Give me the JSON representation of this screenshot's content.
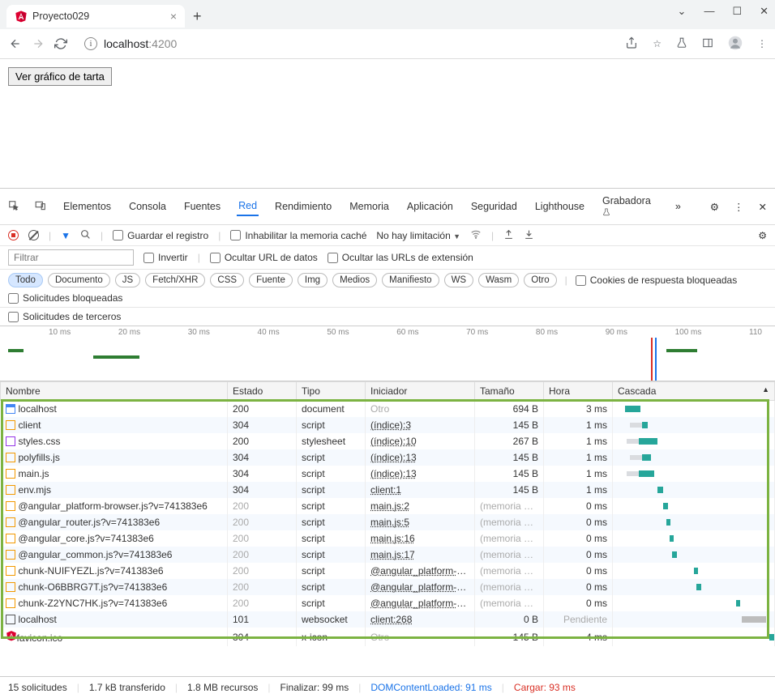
{
  "browser": {
    "tab_title": "Proyecto029",
    "url_host": "localhost",
    "url_port": ":4200"
  },
  "page": {
    "button_label": "Ver gráfico de tarta"
  },
  "devtools": {
    "tabs": {
      "elements": "Elementos",
      "console": "Consola",
      "sources": "Fuentes",
      "network": "Red",
      "performance": "Rendimiento",
      "memory": "Memoria",
      "application": "Aplicación",
      "security": "Seguridad",
      "lighthouse": "Lighthouse",
      "recorder": "Grabadora"
    },
    "toolbar": {
      "preserve_log": "Guardar el registro",
      "disable_cache": "Inhabilitar la memoria caché",
      "throttling": "No hay limitación"
    },
    "filter": {
      "placeholder": "Filtrar",
      "invert": "Invertir",
      "hide_data": "Ocultar URL de datos",
      "hide_ext": "Ocultar las URLs de extensión"
    },
    "types": {
      "all": "Todo",
      "doc": "Documento",
      "js": "JS",
      "fetch": "Fetch/XHR",
      "css": "CSS",
      "font": "Fuente",
      "img": "Img",
      "media": "Medios",
      "manifest": "Manifiesto",
      "ws": "WS",
      "wasm": "Wasm",
      "other": "Otro"
    },
    "blocked_cookies": "Cookies de respuesta bloqueadas",
    "blocked_requests": "Solicitudes bloqueadas",
    "third_party": "Solicitudes de terceros",
    "timeline_ticks": [
      "10 ms",
      "20 ms",
      "30 ms",
      "40 ms",
      "50 ms",
      "60 ms",
      "70 ms",
      "80 ms",
      "90 ms",
      "100 ms",
      "110"
    ],
    "columns": {
      "name": "Nombre",
      "status": "Estado",
      "type": "Tipo",
      "initiator": "Iniciador",
      "size": "Tamaño",
      "time": "Hora",
      "waterfall": "Cascada"
    },
    "rows": [
      {
        "icon": "doc",
        "name": "localhost",
        "status": "200",
        "type": "document",
        "initiator": "Otro",
        "init_muted": true,
        "size": "694 B",
        "time": "3 ms",
        "wf_l": 5,
        "wf_w": 10
      },
      {
        "icon": "js",
        "name": "client",
        "status": "304",
        "type": "script",
        "initiator": "(índice):3",
        "size": "145 B",
        "time": "1 ms",
        "wf_l": 16,
        "wf_w": 4,
        "wf_wait": 8
      },
      {
        "icon": "css",
        "name": "styles.css",
        "status": "200",
        "type": "stylesheet",
        "initiator": "(índice):10",
        "size": "267 B",
        "time": "1 ms",
        "wf_l": 14,
        "wf_w": 12,
        "wf_wait": 8
      },
      {
        "icon": "js",
        "name": "polyfills.js",
        "status": "304",
        "type": "script",
        "initiator": "(índice):13",
        "size": "145 B",
        "time": "1 ms",
        "wf_l": 16,
        "wf_w": 6,
        "wf_wait": 8
      },
      {
        "icon": "js",
        "name": "main.js",
        "status": "304",
        "type": "script",
        "initiator": "(índice):13",
        "size": "145 B",
        "time": "1 ms",
        "wf_l": 14,
        "wf_w": 10,
        "wf_wait": 8
      },
      {
        "icon": "js",
        "name": "env.mjs",
        "status": "304",
        "type": "script",
        "initiator": "client:1",
        "size": "145 B",
        "time": "1 ms",
        "wf_l": 26,
        "wf_w": 4
      },
      {
        "icon": "js",
        "name": "@angular_platform-browser.js?v=741383e6",
        "status": "200",
        "status_muted": true,
        "type": "script",
        "initiator": "main.js:2",
        "size": "(memoria ca...",
        "size_muted": true,
        "time": "0 ms",
        "wf_l": 30,
        "wf_w": 3
      },
      {
        "icon": "js",
        "name": "@angular_router.js?v=741383e6",
        "status": "200",
        "status_muted": true,
        "type": "script",
        "initiator": "main.js:5",
        "size": "(memoria ca...",
        "size_muted": true,
        "time": "0 ms",
        "wf_l": 32,
        "wf_w": 3
      },
      {
        "icon": "js",
        "name": "@angular_core.js?v=741383e6",
        "status": "200",
        "status_muted": true,
        "type": "script",
        "initiator": "main.js:16",
        "size": "(memoria ca...",
        "size_muted": true,
        "time": "0 ms",
        "wf_l": 34,
        "wf_w": 3
      },
      {
        "icon": "js",
        "name": "@angular_common.js?v=741383e6",
        "status": "200",
        "status_muted": true,
        "type": "script",
        "initiator": "main.js:17",
        "size": "(memoria ca...",
        "size_muted": true,
        "time": "0 ms",
        "wf_l": 36,
        "wf_w": 3
      },
      {
        "icon": "js",
        "name": "chunk-NUIFYEZL.js?v=741383e6",
        "status": "200",
        "status_muted": true,
        "type": "script",
        "initiator": "@angular_platform-br...",
        "size": "(memoria ca...",
        "size_muted": true,
        "time": "0 ms",
        "wf_l": 50,
        "wf_w": 3
      },
      {
        "icon": "js",
        "name": "chunk-O6BBRG7T.js?v=741383e6",
        "status": "200",
        "status_muted": true,
        "type": "script",
        "initiator": "@angular_platform-br...",
        "size": "(memoria ca...",
        "size_muted": true,
        "time": "0 ms",
        "wf_l": 52,
        "wf_w": 3
      },
      {
        "icon": "js",
        "name": "chunk-Z2YNC7HK.js?v=741383e6",
        "status": "200",
        "status_muted": true,
        "type": "script",
        "initiator": "@angular_platform-br...",
        "size": "(memoria ca...",
        "size_muted": true,
        "time": "0 ms",
        "wf_l": 78,
        "wf_w": 3
      },
      {
        "icon": "ws",
        "name": "localhost",
        "status": "101",
        "type": "websocket",
        "initiator": "client:268",
        "size": "0 B",
        "time": "Pendiente",
        "time_muted": true,
        "wf_l": 82,
        "wf_w": 16,
        "wf_gray": true
      },
      {
        "icon": "ang",
        "name": "favicon.ico",
        "status": "304",
        "type": "x-icon",
        "initiator": "Otro",
        "init_muted": true,
        "size": "145 B",
        "time": "4 ms",
        "wf_l": 100,
        "wf_w": 4
      }
    ],
    "status": {
      "requests": "15 solicitudes",
      "transferred": "1.7 kB transferido",
      "resources": "1.8 MB recursos",
      "finish": "Finalizar: 99 ms",
      "domloaded": "DOMContentLoaded: 91 ms",
      "load": "Cargar: 93 ms"
    }
  }
}
